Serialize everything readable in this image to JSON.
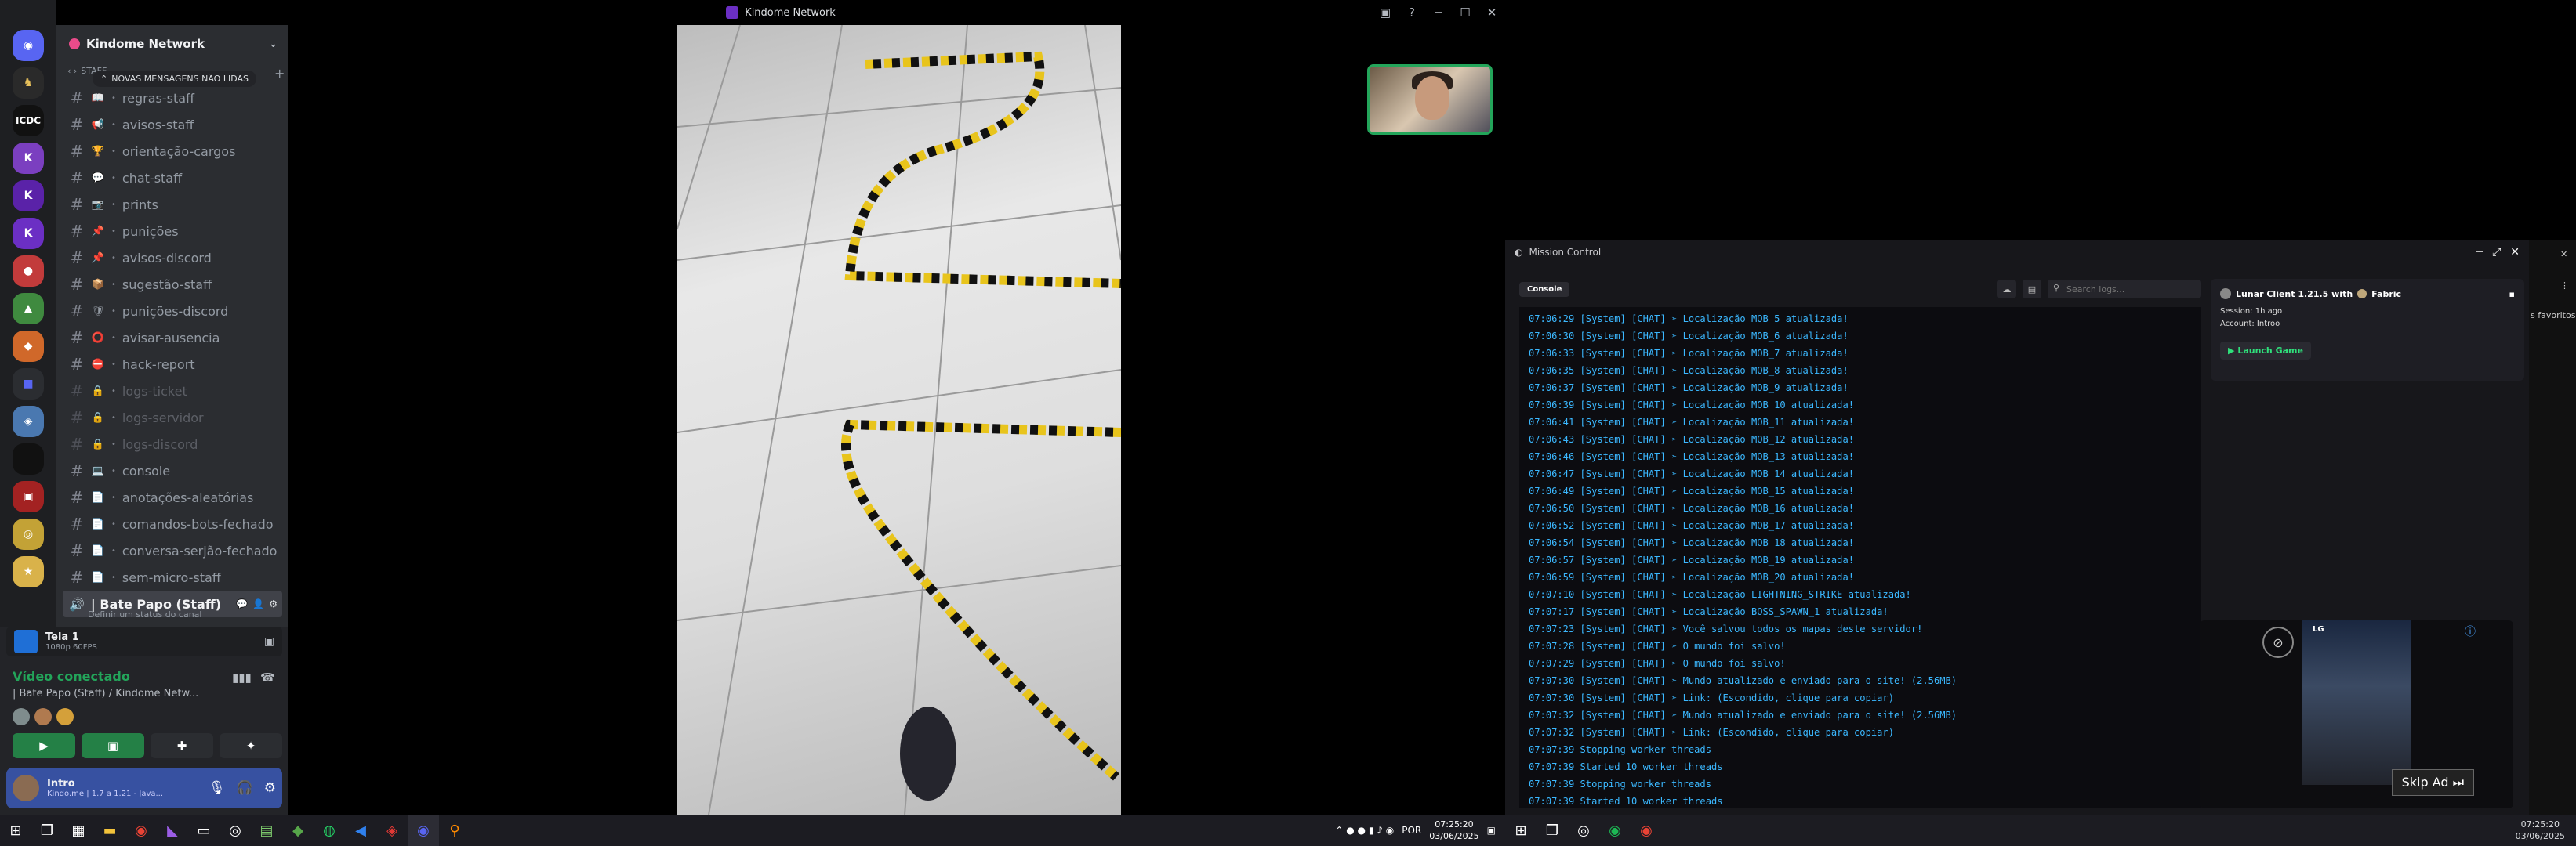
{
  "window": {
    "title": "Kindome Network"
  },
  "guild": {
    "name": "Kindome Network",
    "new_messages_banner": "NOVAS MENSAGENS NÃO LIDAS",
    "category": "STAFF"
  },
  "channels": [
    {
      "name": "regras-staff",
      "emoji": "📖",
      "muted": false
    },
    {
      "name": "avisos-staff",
      "emoji": "📢",
      "muted": false
    },
    {
      "name": "orientação-cargos",
      "emoji": "🏆",
      "muted": false
    },
    {
      "name": "chat-staff",
      "emoji": "💬",
      "muted": false
    },
    {
      "name": "prints",
      "emoji": "📷",
      "muted": false
    },
    {
      "name": "punições",
      "emoji": "📌",
      "muted": false
    },
    {
      "name": "avisos-discord",
      "emoji": "📌",
      "muted": false
    },
    {
      "name": "sugestão-staff",
      "emoji": "📦",
      "muted": false
    },
    {
      "name": "punições-discord",
      "emoji": "🛡",
      "muted": false
    },
    {
      "name": "avisar-ausencia",
      "emoji": "⭕",
      "muted": false
    },
    {
      "name": "hack-report",
      "emoji": "⛔",
      "muted": false
    },
    {
      "name": "logs-ticket",
      "emoji": "🔒",
      "muted": true
    },
    {
      "name": "logs-servidor",
      "emoji": "🔒",
      "muted": true
    },
    {
      "name": "logs-discord",
      "emoji": "🔒",
      "muted": true
    },
    {
      "name": "console",
      "emoji": "💻",
      "muted": false
    },
    {
      "name": "anotações-aleatórias",
      "emoji": "📄",
      "muted": false
    },
    {
      "name": "comandos-bots-fechado",
      "emoji": "📄",
      "muted": false
    },
    {
      "name": "conversa-serjão-fechado",
      "emoji": "📄",
      "muted": false
    },
    {
      "name": "sem-micro-staff",
      "emoji": "📄",
      "muted": false
    }
  ],
  "active_voice_channel": {
    "name": "| Bate Papo (Staff)",
    "status": "Definir um status do canal"
  },
  "stream": {
    "name": "Tela 1",
    "quality": "1080p 60FPS"
  },
  "voice": {
    "status": "Vídeo conectado",
    "channel": "| Bate Papo (Staff) / Kindome Netw..."
  },
  "user": {
    "name": "Intro",
    "status": "Kindo.me | 1.7 a 1.21 - Java..."
  },
  "mission_control": {
    "title": "Mission Control",
    "tab": "Console",
    "search_placeholder": "Search logs...",
    "client": {
      "title": "Lunar Client 1.21.5 with",
      "loader": "Fabric",
      "session": "Session: 1h ago",
      "account": "Account: Introo",
      "launch": "Launch Game"
    },
    "logs": [
      "07:06:29 [System] [CHAT] ➣ Localização MOB_5 atualizada!",
      "07:06:30 [System] [CHAT] ➣ Localização MOB_6 atualizada!",
      "07:06:33 [System] [CHAT] ➣ Localização MOB_7 atualizada!",
      "07:06:35 [System] [CHAT] ➣ Localização MOB_8 atualizada!",
      "07:06:37 [System] [CHAT] ➣ Localização MOB_9 atualizada!",
      "07:06:39 [System] [CHAT] ➣ Localização MOB_10 atualizada!",
      "07:06:41 [System] [CHAT] ➣ Localização MOB_11 atualizada!",
      "07:06:43 [System] [CHAT] ➣ Localização MOB_12 atualizada!",
      "07:06:46 [System] [CHAT] ➣ Localização MOB_13 atualizada!",
      "07:06:47 [System] [CHAT] ➣ Localização MOB_14 atualizada!",
      "07:06:49 [System] [CHAT] ➣ Localização MOB_15 atualizada!",
      "07:06:50 [System] [CHAT] ➣ Localização MOB_16 atualizada!",
      "07:06:52 [System] [CHAT] ➣ Localização MOB_17 atualizada!",
      "07:06:54 [System] [CHAT] ➣ Localização MOB_18 atualizada!",
      "07:06:57 [System] [CHAT] ➣ Localização MOB_19 atualizada!",
      "07:06:59 [System] [CHAT] ➣ Localização MOB_20 atualizada!",
      "07:07:10 [System] [CHAT] ➣ Localização LIGHTNING_STRIKE atualizada!",
      "07:07:17 [System] [CHAT] ➣ Localização BOSS_SPAWN_1 atualizada!",
      "07:07:23 [System] [CHAT] ➣ Você salvou todos os mapas deste servidor!",
      "07:07:28 [System] [CHAT] ➣ O mundo foi salvo!",
      "07:07:29 [System] [CHAT] ➣ O mundo foi salvo!",
      "07:07:30 [System] [CHAT] ➣ Mundo atualizado e enviado para o site! (2.56MB)",
      "07:07:30 [System] [CHAT] ➣ Link: (Escondido, clique para copiar)",
      "07:07:32 [System] [CHAT] ➣ Mundo atualizado e enviado para o site! (2.56MB)",
      "07:07:32 [System] [CHAT] ➣ Link: (Escondido, clique para copiar)",
      "07:07:39 Stopping worker threads",
      "07:07:39 Started 10 worker threads",
      "07:07:39 Stopping worker threads",
      "07:07:39 Started 10 worker threads"
    ]
  },
  "ad": {
    "skip_label": "Skip Ad ⏭",
    "brand": "LG"
  },
  "side_strip": {
    "label": "s favoritos"
  },
  "taskbar_left": {
    "lang": "POR",
    "time": "07:25:20",
    "date": "03/06/2025"
  },
  "taskbar_right": {
    "time": "07:25:20",
    "date": "03/06/2025"
  }
}
